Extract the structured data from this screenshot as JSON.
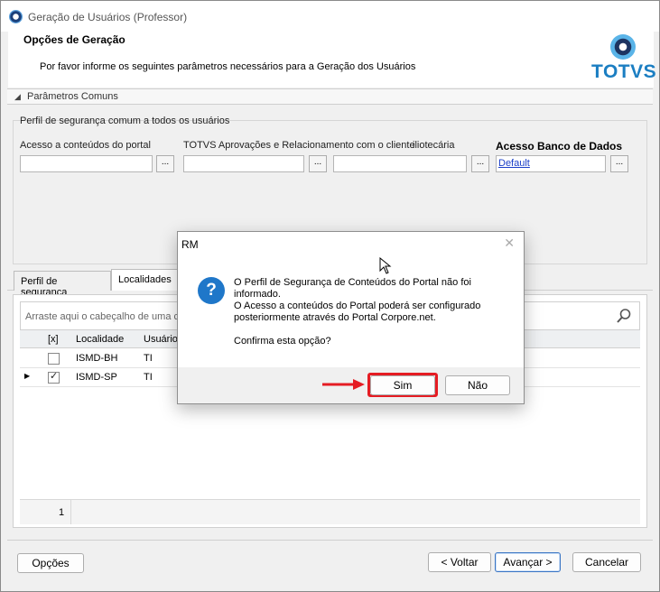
{
  "window": {
    "title": "Geração de Usuários (Professor)"
  },
  "header": {
    "title": "Opções de Geração",
    "subtitle": "Por favor informe os seguintes parâmetros necessários para a Geração dos Usuários",
    "logo_text": "TOTVS"
  },
  "group": {
    "label": "Parâmetros Comuns",
    "profile_label": "Perfil de segurança comum a todos os usuários",
    "fields": [
      {
        "label": "Acesso a conteúdos do portal",
        "value": ""
      },
      {
        "label": "TOTVS Aprovações e Relacionamento com o cliente",
        "value": ""
      },
      {
        "label": "iliotecária",
        "value": ""
      },
      {
        "label": "Acesso Banco de Dados",
        "value": "Default"
      }
    ],
    "browse_button": "..."
  },
  "tabs": [
    {
      "label": "Perfil de segurança",
      "active": false
    },
    {
      "label": "Localidades",
      "active": true
    }
  ],
  "grid": {
    "group_hint": "Arraste aqui o cabeçalho de uma co",
    "columns": [
      "[x]",
      "Localidade",
      "Usuário"
    ],
    "rows": [
      {
        "checked": false,
        "localidade": "ISMD-BH",
        "usuario": "TI",
        "current": false
      },
      {
        "checked": true,
        "localidade": "ISMD-SP",
        "usuario": "TI",
        "current": true
      }
    ],
    "footer_count": "1"
  },
  "buttons": {
    "options": "Opções",
    "back": "< Voltar",
    "next": "Avançar >",
    "cancel": "Cancelar"
  },
  "dialog": {
    "title": "RM",
    "lines": [
      "O Perfil de Segurança de Conteúdos do Portal não foi",
      "informado.",
      "O Acesso a conteúdos do Portal poderá ser configurado",
      "posteriormente através do Portal Corpore.net.",
      "",
      "Confirma esta opção?"
    ],
    "yes": "Sim",
    "no": "Não",
    "icon": "question-icon"
  },
  "colors": {
    "accent": "#1f77c9",
    "highlight": "#e51c23",
    "link": "#1a3ec8",
    "logo": "#1b7ec2"
  }
}
